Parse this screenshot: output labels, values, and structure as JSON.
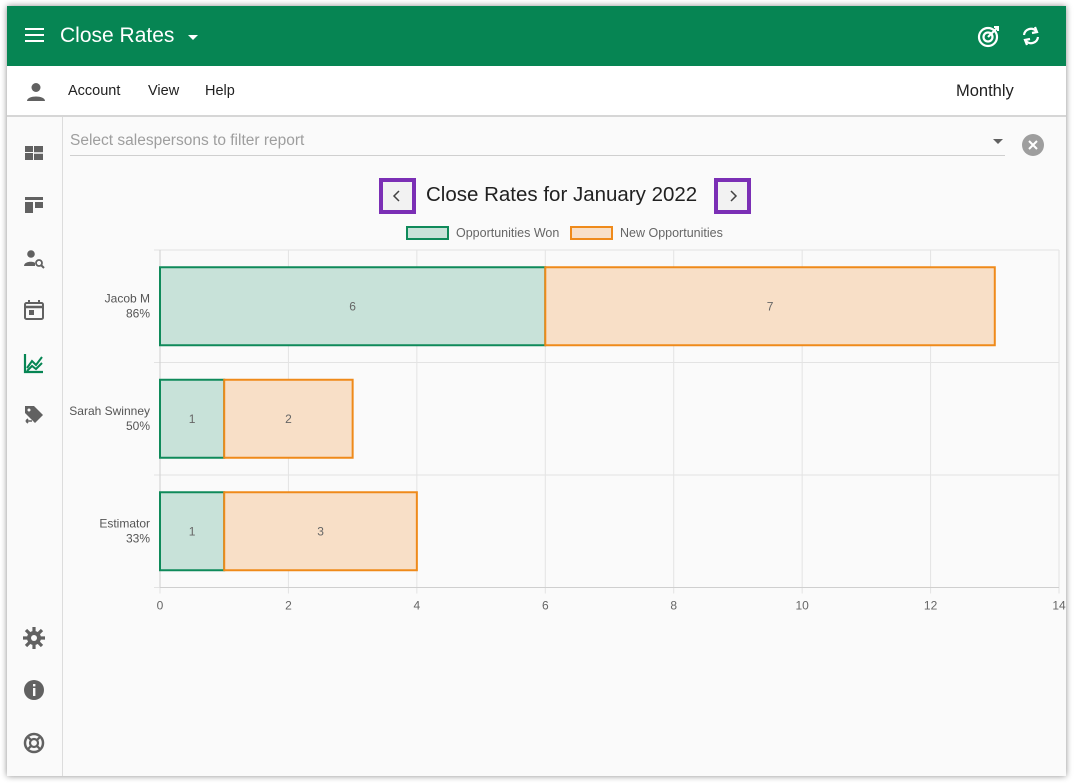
{
  "app": {
    "title": "Close Rates"
  },
  "menubar": {
    "items": [
      "Account",
      "View",
      "Help"
    ],
    "period": "Monthly"
  },
  "sidebar": {
    "items": [
      {
        "icon": "dashboard-icon"
      },
      {
        "icon": "board-icon"
      },
      {
        "icon": "person-search-icon"
      },
      {
        "icon": "calendar-icon"
      },
      {
        "icon": "chart-line-icon",
        "active": true
      },
      {
        "icon": "tag-transfer-icon"
      },
      {
        "icon": "settings-icon"
      },
      {
        "icon": "info-icon"
      },
      {
        "icon": "help-lifebuoy-icon"
      }
    ]
  },
  "filter": {
    "placeholder": "Select salespersons to filter report"
  },
  "report": {
    "title": "Close Rates for January 2022"
  },
  "colors": {
    "brand": "#068553",
    "won_fill": "#c8e2d9",
    "won_border": "#0f8a5a",
    "new_fill": "#f8dfc7",
    "new_border": "#ef8a1a",
    "highlight": "#7b2fb5"
  },
  "chart_data": {
    "type": "bar",
    "orientation": "horizontal",
    "stacked": true,
    "categories": [
      "Jacob M",
      "Sarah Swinney",
      "Estimator"
    ],
    "category_rates": [
      "86%",
      "50%",
      "33%"
    ],
    "series": [
      {
        "name": "Opportunities Won",
        "values": [
          6,
          1,
          1
        ]
      },
      {
        "name": "New Opportunities",
        "values": [
          7,
          2,
          3
        ]
      }
    ],
    "xlim": [
      0,
      14
    ],
    "xticks": [
      0,
      2,
      4,
      6,
      8,
      10,
      12,
      14
    ],
    "grid": true,
    "legend": "top-center"
  }
}
